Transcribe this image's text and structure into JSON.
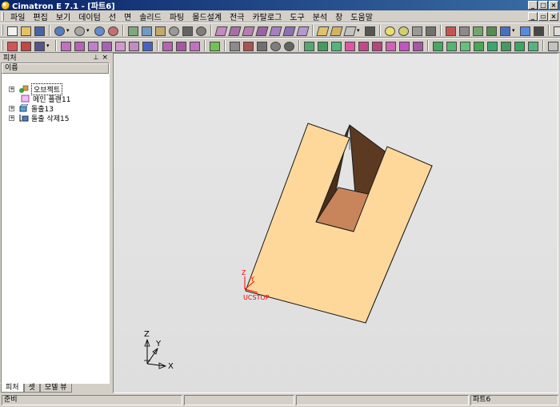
{
  "window": {
    "title": "Cimatron E 7.1 - [파트6]"
  },
  "menu": [
    {
      "label": "파일"
    },
    {
      "label": "편집"
    },
    {
      "label": "보기"
    },
    {
      "label": "데이텀"
    },
    {
      "label": "선"
    },
    {
      "label": "면"
    },
    {
      "label": "솔리드"
    },
    {
      "label": "파팅"
    },
    {
      "label": "몰드설계"
    },
    {
      "label": "전극"
    },
    {
      "label": "카탈로그"
    },
    {
      "label": "도구"
    },
    {
      "label": "분석"
    },
    {
      "label": "창"
    },
    {
      "label": "도움말"
    }
  ],
  "panel": {
    "title": "피처",
    "pin": "ㅁ",
    "close": "×",
    "column": "이름"
  },
  "tree": [
    {
      "label": "오브젝트",
      "expander": "+"
    },
    {
      "label": "메인 플랜11"
    },
    {
      "label": "돌출13",
      "expander": "+"
    },
    {
      "label": "돌출 삭제15",
      "expander": "+"
    }
  ],
  "tabs": [
    {
      "label": "피처"
    },
    {
      "label": "셋"
    },
    {
      "label": "모델 뷰"
    }
  ],
  "viewport": {
    "ucs_axis_label": "Z",
    "ucs_axis_y": "Y",
    "ucs_name": "UCSTOP",
    "triad": {
      "z": "Z",
      "y": "Y",
      "x": "X"
    },
    "colors": {
      "top": "#fed89a",
      "side": "#5c3a22",
      "slot_floor": "#c8845a",
      "edge": "#1a1a1a",
      "ucs": "#ff0000"
    }
  },
  "status": {
    "left": "준비",
    "part": "파트6"
  },
  "icons": {
    "toolbar1": [
      "new-file-icon",
      "open-file-icon",
      "save-icon",
      "undo-icon",
      "redo-icon",
      "link-icon",
      "settings-icon",
      "zoom-box-icon",
      "zoom-icon",
      "pan-icon",
      "rotate-icon",
      "cube-icon",
      "cube-shaded-icon",
      "cube-wire-icon",
      "cube-hidden-icon",
      "cube-solid-icon",
      "view-front-icon",
      "view-top-icon",
      "lamp-icon",
      "lamp-off-icon",
      "arrow-left-icon",
      "arrow-right-icon",
      "filter-icon",
      "color-icon",
      "brush-icon",
      "help-icon"
    ],
    "toolbar2": [
      "delete-icon",
      "pick-icon",
      "point-icon",
      "line-icon",
      "arc-icon",
      "circle-icon",
      "curve-icon",
      "face-icon",
      "solid-icon",
      "extrude-icon",
      "revolve-icon",
      "sweep-icon",
      "blend-icon",
      "split-icon",
      "parting-icon",
      "mold-icon"
    ]
  }
}
